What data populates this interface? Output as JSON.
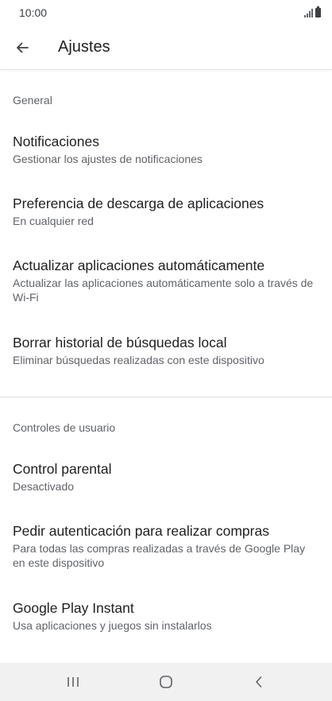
{
  "status_bar": {
    "time": "10:00"
  },
  "app_bar": {
    "title": "Ajustes"
  },
  "sections": [
    {
      "header": "General",
      "items": [
        {
          "title": "Notificaciones",
          "subtitle": "Gestionar los ajustes de notificaciones"
        },
        {
          "title": "Preferencia de descarga de aplicaciones",
          "subtitle": "En cualquier red"
        },
        {
          "title": "Actualizar aplicaciones automáticamente",
          "subtitle": "Actualizar las aplicaciones automáticamente solo a través de Wi-Fi"
        },
        {
          "title": "Borrar historial de búsquedas local",
          "subtitle": "Eliminar búsquedas realizadas con este dispositivo"
        }
      ]
    },
    {
      "header": "Controles de usuario",
      "items": [
        {
          "title": "Control parental",
          "subtitle": "Desactivado"
        },
        {
          "title": "Pedir autenticación para realizar compras",
          "subtitle": "Para todas las compras realizadas a través de Google Play en este dispositivo"
        },
        {
          "title": "Google Play Instant",
          "subtitle": "Usa aplicaciones y juegos sin instalarlos"
        }
      ]
    }
  ],
  "nav_bar": {
    "icons": [
      "recents-icon",
      "home-icon",
      "back-icon"
    ]
  },
  "colors": {
    "text_primary": "#202124",
    "text_secondary": "#5f6368",
    "divider": "#dadce0",
    "nav_bg": "#f1f1f1"
  }
}
